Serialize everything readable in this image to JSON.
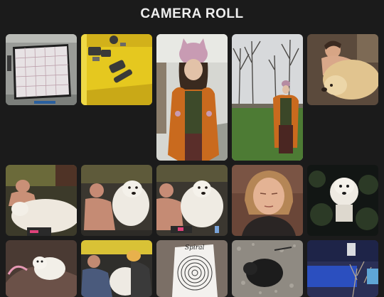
{
  "header": {
    "title": "CAMERA ROLL"
  },
  "photos": [
    {
      "icon": "bingo-card-photo"
    },
    {
      "icon": "toys-in-yellow-bin-photo"
    },
    {
      "icon": "person-pink-beanie-photo"
    },
    {
      "icon": "person-orange-cardigan-outdoors-photo"
    },
    {
      "icon": "person-with-golden-dog-photo"
    },
    {
      "icon": "man-with-white-dog-on-couch-photo"
    },
    {
      "icon": "man-hugging-white-dog-photo"
    },
    {
      "icon": "man-and-white-dog-photo"
    },
    {
      "icon": "woman-eyes-closed-photo"
    },
    {
      "icon": "white-dog-at-night-photo"
    },
    {
      "icon": "white-dog-on-rug-photo"
    },
    {
      "icon": "people-on-couch-with-dog-photo"
    },
    {
      "icon": "spiral-drawing-paper-photo"
    },
    {
      "icon": "black-pig-on-gravel-photo"
    },
    {
      "icon": "blue-pool-outdoors-photo"
    }
  ],
  "spiral_paper": {
    "heading": "Spiral"
  }
}
